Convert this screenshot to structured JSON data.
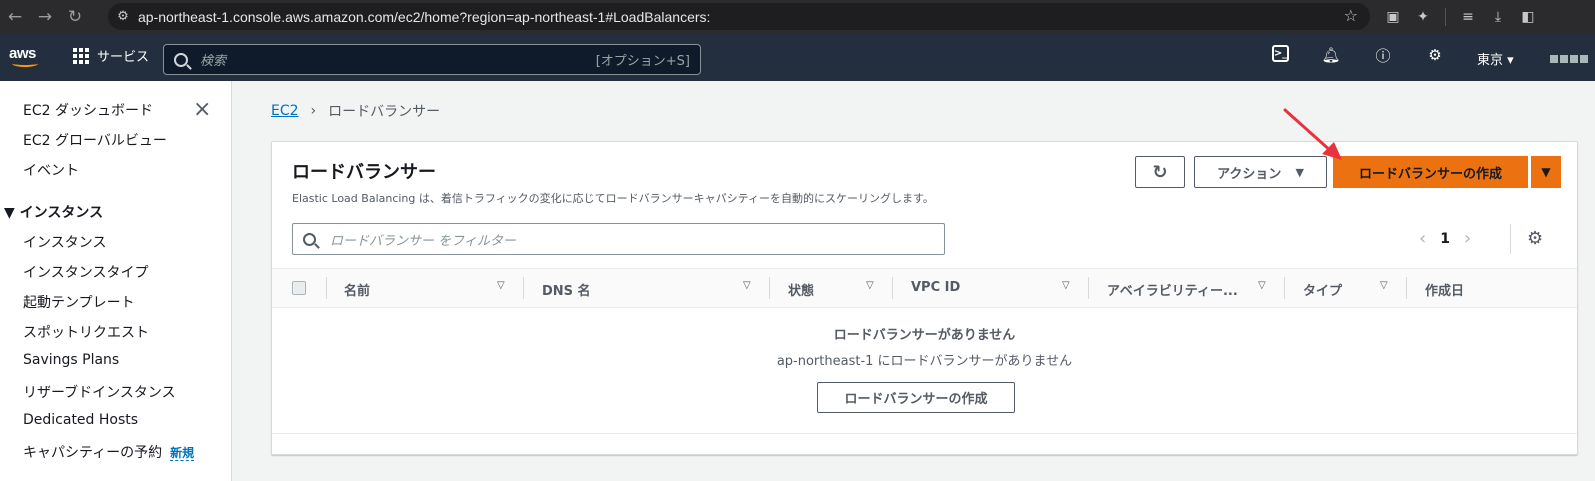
{
  "browser": {
    "url": "ap-northeast-1.console.aws.amazon.com/ec2/home?region=ap-northeast-1#LoadBalancers:"
  },
  "aws_nav": {
    "logo": "aws",
    "services_label": "サービス",
    "search_placeholder": "検索",
    "search_shortcut": "[オプション+S]",
    "region": "東京 ▾"
  },
  "sidebar": {
    "items": [
      {
        "label": "EC2 ダッシュボード"
      },
      {
        "label": "EC2 グローバルビュー"
      },
      {
        "label": "イベント"
      },
      {
        "label": "▼  インスタンス"
      },
      {
        "label": "インスタンス"
      },
      {
        "label": "インスタンスタイプ"
      },
      {
        "label": "起動テンプレート"
      },
      {
        "label": "スポットリクエスト"
      },
      {
        "label": "Savings Plans"
      },
      {
        "label": "リザーブドインスタンス"
      },
      {
        "label": "Dedicated Hosts"
      },
      {
        "label": "キャパシティーの予約"
      }
    ],
    "new_badge": "新規"
  },
  "breadcrumb": {
    "root": "EC2",
    "current": "ロードバランサー"
  },
  "panel": {
    "title": "ロードバランサー",
    "description": "Elastic Load Balancing は、着信トラフィックの変化に応じてロードバランサーキャパシティーを自動的にスケーリングします。",
    "actions_label": "アクション",
    "create_label": "ロードバランサーの作成",
    "filter_placeholder": "ロードバランサー をフィルター",
    "page_number": "1",
    "columns": [
      "名前",
      "DNS 名",
      "状態",
      "VPC ID",
      "アベイラビリティー...",
      "タイプ",
      "作成日"
    ],
    "empty_title": "ロードバランサーがありません",
    "empty_subtitle": "ap-northeast-1 にロードバランサーがありません",
    "empty_create_label": "ロードバランサーの作成"
  },
  "colors": {
    "aws_nav": "#232f3e",
    "primary_button": "#ec7211",
    "link": "#0073bb",
    "annotation_arrow": "#e8333c"
  }
}
